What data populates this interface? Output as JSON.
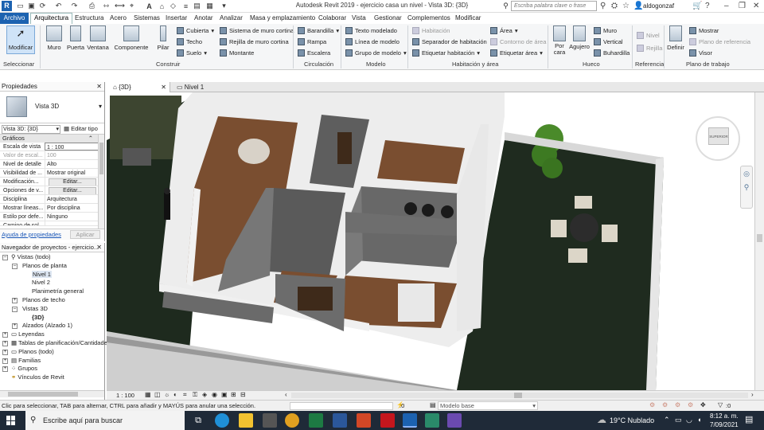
{
  "titlebar": {
    "title": "Autodesk Revit 2019 - ejercicio casa un nivel - Vista 3D: {3D}",
    "search_placeholder": "Escriba palabra clave o frase",
    "user": "aldogonzaf"
  },
  "menu": {
    "archivo": "Archivo",
    "tabs": [
      "Arquitectura",
      "Estructura",
      "Acero",
      "Sistemas",
      "Insertar",
      "Anotar",
      "Analizar",
      "Masa y emplazamiento",
      "Colaborar",
      "Vista",
      "Gestionar",
      "Complementos",
      "Modificar"
    ]
  },
  "ribbon": {
    "modificar": "Modificar",
    "seleccionar": "Seleccionar",
    "muro": "Muro",
    "puerta": "Puerta",
    "ventana": "Ventana",
    "componente": "Componente",
    "pilar": "Pilar",
    "cubierta": "Cubierta",
    "techo": "Techo",
    "suelo": "Suelo",
    "sistema_muro_cortina": "Sistema de muro cortina",
    "rejilla_muro_cortina": "Rejilla de muro cortina",
    "montante": "Montante",
    "construir": "Construir",
    "barandilla": "Barandilla",
    "rampa": "Rampa",
    "escalera": "Escalera",
    "circulacion": "Circulación",
    "texto_modelado": "Texto modelado",
    "linea_modelo": "Línea de modelo",
    "grupo_modelo": "Grupo de modelo",
    "modelo": "Modelo",
    "habitacion": "Habitación",
    "separador_habitacion": "Separador de habitación",
    "etiquetar_habitacion": "Etiquetar habitación",
    "area": "Área",
    "contorno_area": "Contorno de área",
    "etiquetar_area": "Etiquetar área",
    "habitacion_area": "Habitación y área",
    "por_cara": "Por cara",
    "agujero": "Agujero",
    "hueco_muro": "Muro",
    "vertical": "Vertical",
    "buhardilla": "Buhardilla",
    "hueco": "Hueco",
    "nivel": "Nivel",
    "rejilla": "Rejilla",
    "referencia": "Referencia",
    "definir": "Definir",
    "mostrar": "Mostrar",
    "plano_referencia": "Plano de referencia",
    "visor": "Visor",
    "plano_trabajo": "Plano de trabajo"
  },
  "properties": {
    "title": "Propiedades",
    "type_name": "Vista 3D",
    "selector": "Vista 3D: {3D}",
    "edit_type": "Editar tipo",
    "group": "Gráficos",
    "rows": [
      {
        "k": "Escala de vista",
        "v": "1 : 100"
      },
      {
        "k": "Valor de escal...",
        "v": "100"
      },
      {
        "k": "Nivel de detalle",
        "v": "Alto"
      },
      {
        "k": "Visibilidad de ...",
        "v": "Mostrar original"
      },
      {
        "k": "Modificación...",
        "v": "Editar..."
      },
      {
        "k": "Opciones de v...",
        "v": "Editar..."
      },
      {
        "k": "Disciplina",
        "v": "Arquitectura"
      },
      {
        "k": "Mostrar líneas...",
        "v": "Por disciplina"
      },
      {
        "k": "Estilo por defe...",
        "v": "Ninguno"
      },
      {
        "k": "Camino de sol",
        "v": ""
      }
    ],
    "help": "Ayuda de propiedades",
    "apply": "Aplicar"
  },
  "navigator": {
    "title": "Navegador de proyectos - ejercicio...",
    "items": [
      {
        "label": "Vistas (todo)",
        "lvl": 0
      },
      {
        "label": "Planos de planta",
        "lvl": 1
      },
      {
        "label": "Nivel 1",
        "lvl": 2
      },
      {
        "label": "Nivel 2",
        "lvl": 2
      },
      {
        "label": "Planimetría general",
        "lvl": 2
      },
      {
        "label": "Planos de techo",
        "lvl": 1
      },
      {
        "label": "Vistas 3D",
        "lvl": 1
      },
      {
        "label": "{3D}",
        "lvl": 2
      },
      {
        "label": "Alzados (Alzado 1)",
        "lvl": 1
      },
      {
        "label": "Leyendas",
        "lvl": 0
      },
      {
        "label": "Tablas de planificación/Cantidades",
        "lvl": 0
      },
      {
        "label": "Planos (todo)",
        "lvl": 0
      },
      {
        "label": "Familias",
        "lvl": 0
      },
      {
        "label": "Grupos",
        "lvl": 0
      },
      {
        "label": "Vínculos de Revit",
        "lvl": 0
      }
    ]
  },
  "view": {
    "tabs": [
      "{3D}",
      "Nivel 1"
    ],
    "scale": "1 : 100",
    "viewcube_label": "SUPERIOR"
  },
  "status": {
    "hint": "Clic para seleccionar, TAB para alternar, CTRL para añadir y MAYÚS para anular una selección.",
    "zero": ":0",
    "model": "Modelo base"
  },
  "taskbar": {
    "search": "Escribe aquí para buscar",
    "weather": "19°C  Nublado",
    "time": "8:12 a. m.",
    "date": "7/09/2021"
  }
}
